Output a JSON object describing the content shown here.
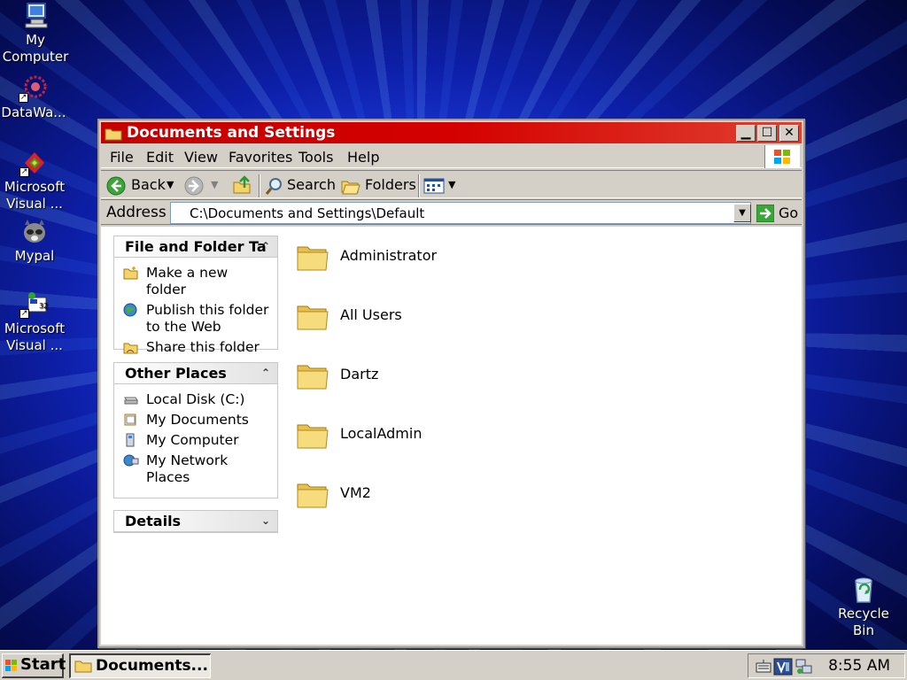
{
  "desktop": {
    "icons": [
      {
        "label": "My Computer",
        "name": "my-computer"
      },
      {
        "label": "DataWa...",
        "name": "datawa"
      },
      {
        "label": "Microsoft Visual ...",
        "name": "microsoft-visual-1"
      },
      {
        "label": "Mypal",
        "name": "mypal"
      },
      {
        "label": "Microsoft Visual ...",
        "name": "microsoft-visual-2"
      },
      {
        "label": "Recycle Bin",
        "name": "recycle-bin"
      }
    ]
  },
  "window": {
    "title": "Documents and Settings",
    "menu": [
      "File",
      "Edit",
      "View",
      "Favorites",
      "Tools",
      "Help"
    ],
    "toolbar": {
      "back": "Back",
      "search": "Search",
      "folders": "Folders"
    },
    "address": {
      "label": "Address",
      "value": "C:\\Documents and Settings\\Default",
      "go": "Go"
    },
    "tasks_panel": {
      "title": "File and Folder Ta",
      "items": [
        "Make a new folder",
        "Publish this folder to the Web",
        "Share this folder"
      ]
    },
    "places_panel": {
      "title": "Other Places",
      "items": [
        "Local Disk (C:)",
        "My Documents",
        "My Computer",
        "My Network Places"
      ]
    },
    "details_panel": {
      "title": "Details"
    },
    "folders": [
      "Administrator",
      "All Users",
      "Dartz",
      "LocalAdmin",
      "VM2"
    ]
  },
  "taskbar": {
    "start": "Start",
    "task": "Documents...",
    "clock": "8:55 AM"
  },
  "colors": {
    "title_bar": "#c40000",
    "window_face": "#d4d0c8",
    "folder_yellow": "#f5d36b"
  }
}
